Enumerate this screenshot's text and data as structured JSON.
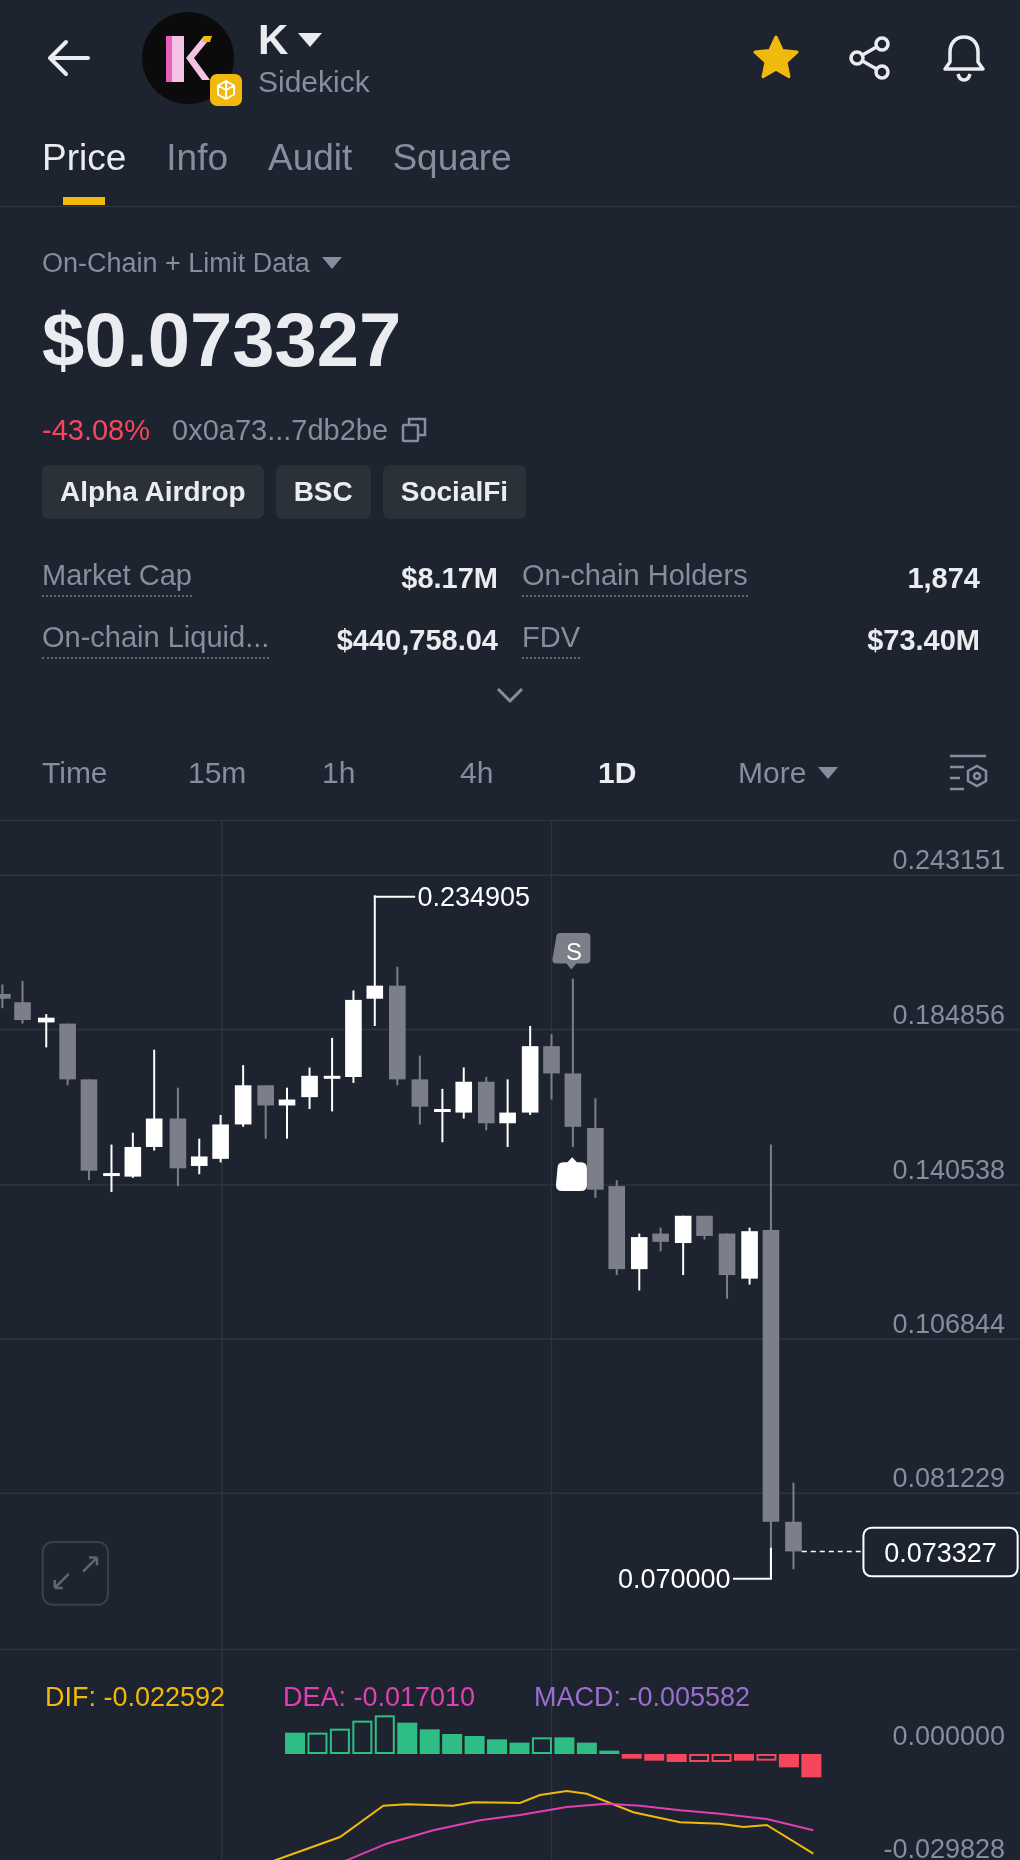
{
  "header": {
    "title": "K",
    "subtitle": "Sidekick",
    "favorite": true
  },
  "tabs": [
    {
      "label": "Price",
      "selected": true
    },
    {
      "label": "Info",
      "selected": false
    },
    {
      "label": "Audit",
      "selected": false
    },
    {
      "label": "Square",
      "selected": false
    }
  ],
  "data_source": "On-Chain + Limit Data",
  "price": "$0.073327",
  "change": "-43.08%",
  "address": "0x0a73...7db2be",
  "tags": [
    "Alpha Airdrop",
    "BSC",
    "SocialFi"
  ],
  "stats": [
    {
      "label": "Market Cap",
      "value": "$8.17M"
    },
    {
      "label": "On-chain Holders",
      "value": "1,874"
    },
    {
      "label": "On-chain Liquid...",
      "value": "$440,758.04"
    },
    {
      "label": "FDV",
      "value": "$73.40M"
    }
  ],
  "timeframes": [
    {
      "label": "Time",
      "selected": false
    },
    {
      "label": "15m",
      "selected": false
    },
    {
      "label": "1h",
      "selected": false
    },
    {
      "label": "4h",
      "selected": false
    },
    {
      "label": "1D",
      "selected": true
    }
  ],
  "more_menu": "More",
  "chart": {
    "price_labels": [
      "0.243151",
      "0.184856",
      "0.140538",
      "0.106844",
      "0.081229"
    ],
    "high_label": "0.234905",
    "low_label": "0.070000",
    "current_price": "0.073327",
    "signal_marker": "S"
  },
  "macd": {
    "dif": "DIF: -0.022592",
    "dea": "DEA: -0.017010",
    "macd": "MACD: -0.005582",
    "labels": [
      "0.000000",
      "-0.029828"
    ]
  }
}
